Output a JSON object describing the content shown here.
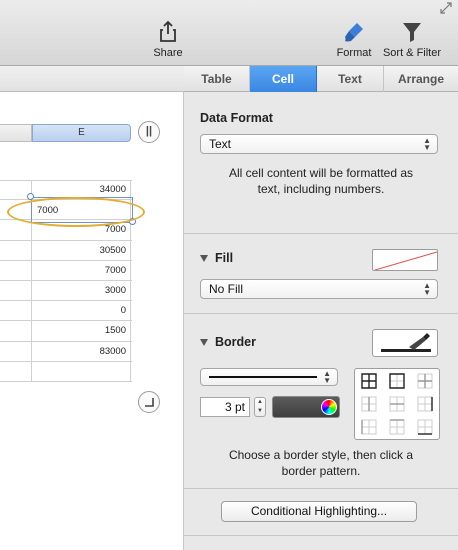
{
  "toolbar": {
    "share_label": "Share",
    "format_label": "Format",
    "sort_filter_label": "Sort & Filter"
  },
  "sheet": {
    "column_header": "E",
    "selected_cell_value": "7000",
    "column_e_values": [
      "34000",
      "",
      "7000",
      "30500",
      "7000",
      "3000",
      "0",
      "1500",
      "83000",
      ""
    ]
  },
  "inspector": {
    "tabs": [
      {
        "label": "Table",
        "active": false
      },
      {
        "label": "Cell",
        "active": true
      },
      {
        "label": "Text",
        "active": false
      },
      {
        "label": "Arrange",
        "active": false
      }
    ],
    "data_format": {
      "title": "Data Format",
      "selected": "Text",
      "help_line1": "All cell content will be formatted as",
      "help_line2": "text, including numbers."
    },
    "fill": {
      "title": "Fill",
      "selected": "No Fill"
    },
    "border": {
      "title": "Border",
      "width_value": "3 pt",
      "color": "#4a4a4a",
      "help_line1": "Choose a border style, then click a",
      "help_line2": "border pattern."
    },
    "conditional_highlighting_label": "Conditional Highlighting..."
  },
  "colors": {
    "accent_tab": "#3b86e3",
    "highlight_ellipse": "#e3ad2f",
    "selection": "#6f93cc"
  }
}
